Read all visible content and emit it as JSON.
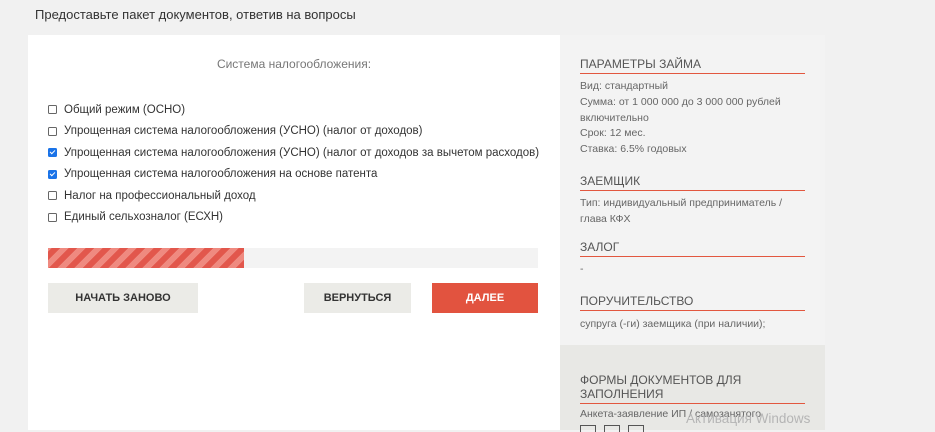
{
  "header": {
    "title": "Предоставьте пакет документов, ответив на вопросы"
  },
  "form": {
    "section_title": "Система налогообложения:",
    "options": [
      {
        "label": "Общий режим (ОСНО)",
        "checked": false
      },
      {
        "label": "Упрощенная система налогообложения (УСНО) (налог от доходов)",
        "checked": false
      },
      {
        "label": "Упрощенная система налогообложения (УСНО) (налог от доходов за вычетом расходов)",
        "checked": true
      },
      {
        "label": "Упрощенная система налогообложения на основе патента",
        "checked": true
      },
      {
        "label": "Налог на профессиональный доход",
        "checked": false
      },
      {
        "label": "Единый сельхозналог (ЕСХН)",
        "checked": false
      }
    ],
    "progress_fraction": 0.4,
    "buttons": {
      "restart_label": "НАЧАТЬ ЗАНОВО",
      "back_label": "ВЕРНУТЬСЯ",
      "next_label": "ДАЛЕЕ"
    }
  },
  "sidebar": {
    "loan_params": {
      "heading": "ПАРАМЕТРЫ ЗАЙМА",
      "lines": [
        "Вид: стандартный",
        "Сумма: от 1 000 000 до 3 000 000 рублей включительно",
        "Срок: 12 мес.",
        "Ставка: 6.5% годовых"
      ]
    },
    "borrower": {
      "heading": "ЗАЕМЩИК",
      "text": "Тип: индивидуальный предприниматель / глава КФХ"
    },
    "collateral": {
      "heading": "ЗАЛОГ",
      "text": "-"
    },
    "guarantee": {
      "heading": "ПОРУЧИТЕЛЬСТВО",
      "text": "супруга (-ги) заемщика (при наличии);"
    },
    "forms": {
      "heading": "ФОРМЫ ДОКУМЕНТОВ ДЛЯ ЗАПОЛНЕНИЯ",
      "text": "Анкета-заявление ИП / самозанятого"
    }
  },
  "watermark": {
    "text": "Активация Windows"
  },
  "colors": {
    "accent": "#e2533f",
    "checkbox": "#1a73e8"
  }
}
